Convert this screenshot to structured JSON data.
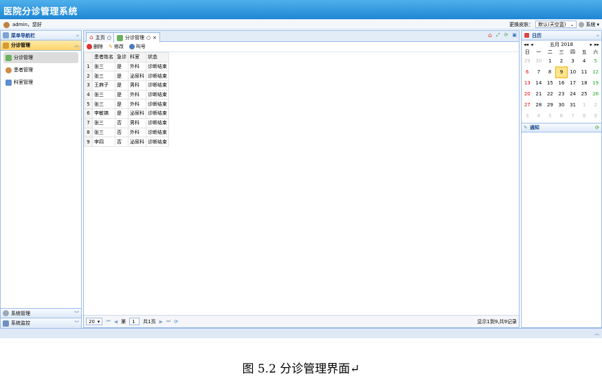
{
  "app": {
    "title": "医院分诊管理系统"
  },
  "user_bar": {
    "greeting": "admin，您好",
    "skin_label": "更换皮肤：",
    "skin_value": "默认(天空蓝)",
    "system_menu": "系统"
  },
  "left_nav": {
    "title": "菜单导航栏",
    "sections": [
      {
        "label": "分诊管理",
        "items": [
          {
            "label": "分诊管理"
          },
          {
            "label": "患者管理"
          },
          {
            "label": "科室管理"
          }
        ]
      },
      {
        "label": "系统管理"
      },
      {
        "label": "系统监控"
      }
    ]
  },
  "tabs": [
    {
      "label": "主页"
    },
    {
      "label": "分诊管理"
    }
  ],
  "toolbar": {
    "delete": "删除",
    "edit": "修改",
    "call": "叫号"
  },
  "grid": {
    "columns": [
      "患者姓名",
      "急诊",
      "科室",
      "状态"
    ],
    "rows": [
      {
        "n": "1",
        "name": "张三",
        "urgent": "是",
        "dept": "外科",
        "status": "诊断结束"
      },
      {
        "n": "2",
        "name": "张三",
        "urgent": "是",
        "dept": "泌尿科",
        "status": "诊断结束"
      },
      {
        "n": "3",
        "name": "王麻子",
        "urgent": "是",
        "dept": "男科",
        "status": "诊断结束"
      },
      {
        "n": "4",
        "name": "张三",
        "urgent": "是",
        "dept": "外科",
        "status": "诊断结束"
      },
      {
        "n": "5",
        "name": "张三",
        "urgent": "是",
        "dept": "外科",
        "status": "诊断结束"
      },
      {
        "n": "6",
        "name": "李敏镐",
        "urgent": "是",
        "dept": "泌尿科",
        "status": "诊断结束"
      },
      {
        "n": "7",
        "name": "张三",
        "urgent": "否",
        "dept": "男科",
        "status": "诊断结束"
      },
      {
        "n": "8",
        "name": "张三",
        "urgent": "否",
        "dept": "外科",
        "status": "诊断结束"
      },
      {
        "n": "9",
        "name": "李四",
        "urgent": "否",
        "dept": "泌尿科",
        "status": "诊断结束"
      }
    ]
  },
  "pager": {
    "page_size": "20",
    "page_prefix": "第",
    "page": "1",
    "page_suffix": "共1页",
    "summary": "显示1到9,共9记录"
  },
  "calendar": {
    "title": "日历",
    "month_label": "五月 2018",
    "weekdays": [
      "日",
      "一",
      "二",
      "三",
      "四",
      "五",
      "六"
    ],
    "weeks": [
      [
        "29",
        "30",
        "1",
        "2",
        "3",
        "4",
        "5"
      ],
      [
        "6",
        "7",
        "8",
        "9",
        "10",
        "11",
        "12"
      ],
      [
        "13",
        "14",
        "15",
        "16",
        "17",
        "18",
        "19"
      ],
      [
        "20",
        "21",
        "22",
        "23",
        "24",
        "25",
        "26"
      ],
      [
        "27",
        "28",
        "29",
        "30",
        "31",
        "1",
        "2"
      ],
      [
        "3",
        "4",
        "5",
        "6",
        "7",
        "8",
        "9"
      ]
    ],
    "today": "9"
  },
  "notice": {
    "title": "通知"
  },
  "caption": "图 5.2  分诊管理界面↵",
  "colors": {
    "banner": "#1f86d4",
    "border": "#99bbe8",
    "selected": "#fcd36a"
  }
}
